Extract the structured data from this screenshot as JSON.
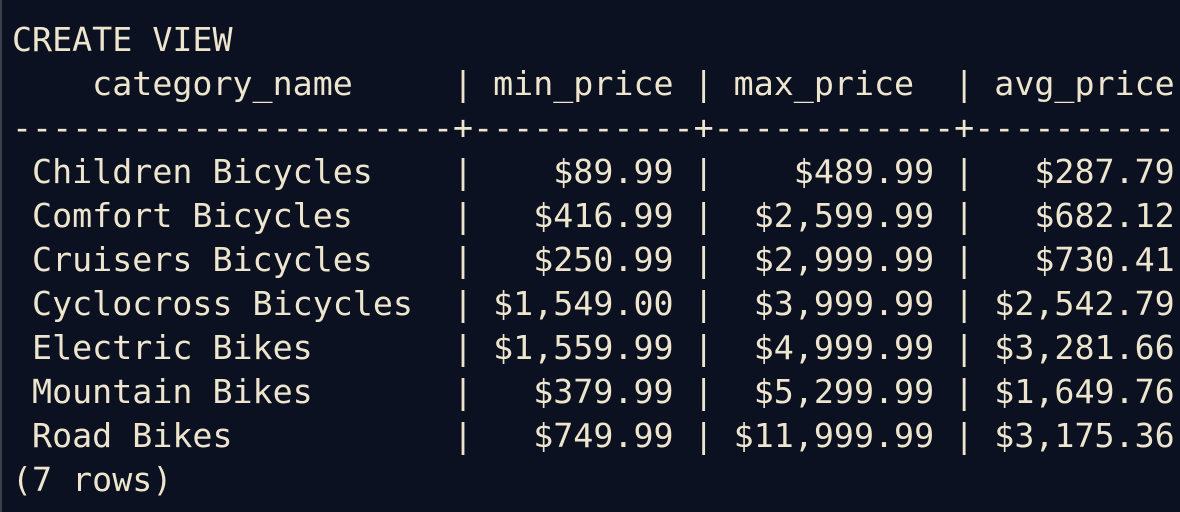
{
  "terminal": {
    "command_output": "CREATE VIEW",
    "header": "    category_name     | min_price | max_price  | avg_price",
    "separator": "----------------------+-----------+------------+-----------",
    "rows": [
      " Children Bicycles    |    $89.99 |    $489.99 |   $287.79",
      " Comfort Bicycles     |   $416.99 |  $2,599.99 |   $682.12",
      " Cruisers Bicycles    |   $250.99 |  $2,999.99 |   $730.41",
      " Cyclocross Bicycles  | $1,549.00 |  $3,999.99 | $2,542.79",
      " Electric Bikes       | $1,559.99 |  $4,999.99 | $3,281.66",
      " Mountain Bikes       |   $379.99 |  $5,299.99 | $1,649.76",
      " Road Bikes           |   $749.99 | $11,999.99 | $3,175.36"
    ],
    "footer": "(7 rows)"
  },
  "table": {
    "columns": [
      "category_name",
      "min_price",
      "max_price",
      "avg_price"
    ],
    "data": [
      [
        "Children Bicycles",
        "$89.99",
        "$489.99",
        "$287.79"
      ],
      [
        "Comfort Bicycles",
        "$416.99",
        "$2,599.99",
        "$682.12"
      ],
      [
        "Cruisers Bicycles",
        "$250.99",
        "$2,999.99",
        "$730.41"
      ],
      [
        "Cyclocross Bicycles",
        "$1,549.00",
        "$3,999.99",
        "$2,542.79"
      ],
      [
        "Electric Bikes",
        "$1,559.99",
        "$4,999.99",
        "$3,281.66"
      ],
      [
        "Mountain Bikes",
        "$379.99",
        "$5,299.99",
        "$1,649.76"
      ],
      [
        "Road Bikes",
        "$749.99",
        "$11,999.99",
        "$3,175.36"
      ]
    ]
  },
  "colors": {
    "background": "#0b1120",
    "text": "#ede5cd"
  }
}
